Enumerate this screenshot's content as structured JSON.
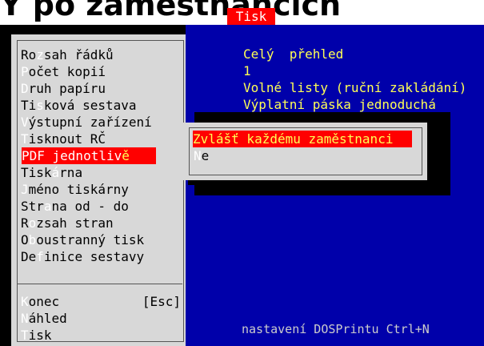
{
  "heading": "Y po zaměstnancích",
  "window_title": "Tisk",
  "menu": {
    "items": [
      {
        "pre": "Ro",
        "hk": "z",
        "post": "sah řádků"
      },
      {
        "pre": "",
        "hk": "P",
        "post": "očet kopií"
      },
      {
        "pre": "",
        "hk": "D",
        "post": "ruh papíru"
      },
      {
        "pre": "Ti",
        "hk": "s",
        "post": "ková sestava"
      },
      {
        "pre": "",
        "hk": "V",
        "post": "ýstupní zařízení"
      },
      {
        "pre": "",
        "hk": "T",
        "post": "isknout RČ"
      },
      {
        "pre": "PDF jednotliv",
        "hk": "ě",
        "post": ""
      },
      {
        "pre": "Tisk",
        "hk": "á",
        "post": "rna"
      },
      {
        "pre": "",
        "hk": "J",
        "post": "méno tiskárny"
      },
      {
        "pre": "Str",
        "hk": "a",
        "post": "na od - do"
      },
      {
        "pre": "R",
        "hk": "o",
        "post": "zsah stran"
      },
      {
        "pre": "O",
        "hk": "b",
        "post": "oustranný tisk"
      },
      {
        "pre": "De",
        "hk": "f",
        "post": "inice sestavy"
      }
    ],
    "actions": [
      {
        "pre": "",
        "hk": "K",
        "post": "onec",
        "shortcut": "[Esc]"
      },
      {
        "pre": "",
        "hk": "N",
        "post": "áhled",
        "shortcut": ""
      },
      {
        "pre": "",
        "hk": "T",
        "post": "isk",
        "shortcut": ""
      }
    ]
  },
  "values": [
    "Celý  přehled",
    "1",
    "Volné listy (ruční zakládání)",
    "Výplatní páska jednoduchá"
  ],
  "popup": {
    "items": [
      {
        "pre": "Zvlášť každému zaměstnanci",
        "hk": "",
        "post": ""
      },
      {
        "pre": "",
        "hk": "N",
        "post": "e"
      }
    ]
  },
  "footer": "nastavení DOSPrintu Ctrl+N",
  "colors": {
    "background": "#0000aa",
    "selection": "#ff0000",
    "value_text": "#ffff55",
    "menu_bg": "#d8d8d8"
  }
}
